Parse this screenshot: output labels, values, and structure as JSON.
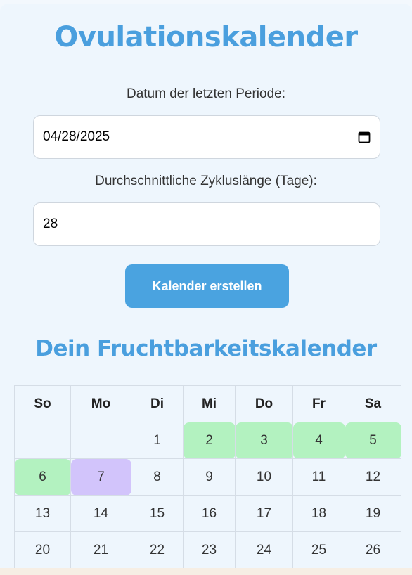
{
  "title": "Ovulationskalender",
  "form": {
    "date_label": "Datum der letzten Periode:",
    "date_value": "04/28/2025",
    "cycle_label": "Durchschnittliche Zykluslänge (Tage):",
    "cycle_value": "28",
    "submit_label": "Kalender erstellen"
  },
  "calendar": {
    "heading": "Dein Fruchtbarkeitskalender",
    "weekdays": [
      "So",
      "Mo",
      "Di",
      "Mi",
      "Do",
      "Fr",
      "Sa"
    ],
    "weeks": [
      [
        {
          "day": ""
        },
        {
          "day": ""
        },
        {
          "day": "1"
        },
        {
          "day": "2",
          "type": "fertile"
        },
        {
          "day": "3",
          "type": "fertile"
        },
        {
          "day": "4",
          "type": "fertile"
        },
        {
          "day": "5",
          "type": "fertile"
        }
      ],
      [
        {
          "day": "6",
          "type": "fertile"
        },
        {
          "day": "7",
          "type": "ovulation"
        },
        {
          "day": "8"
        },
        {
          "day": "9"
        },
        {
          "day": "10"
        },
        {
          "day": "11"
        },
        {
          "day": "12"
        }
      ],
      [
        {
          "day": "13"
        },
        {
          "day": "14"
        },
        {
          "day": "15"
        },
        {
          "day": "16"
        },
        {
          "day": "17"
        },
        {
          "day": "18"
        },
        {
          "day": "19"
        }
      ],
      [
        {
          "day": "20"
        },
        {
          "day": "21"
        },
        {
          "day": "22"
        },
        {
          "day": "23"
        },
        {
          "day": "24"
        },
        {
          "day": "25"
        },
        {
          "day": "26"
        }
      ]
    ],
    "colors": {
      "fertile": "#b3f2c0",
      "ovulation": "#d2c4fb"
    }
  }
}
